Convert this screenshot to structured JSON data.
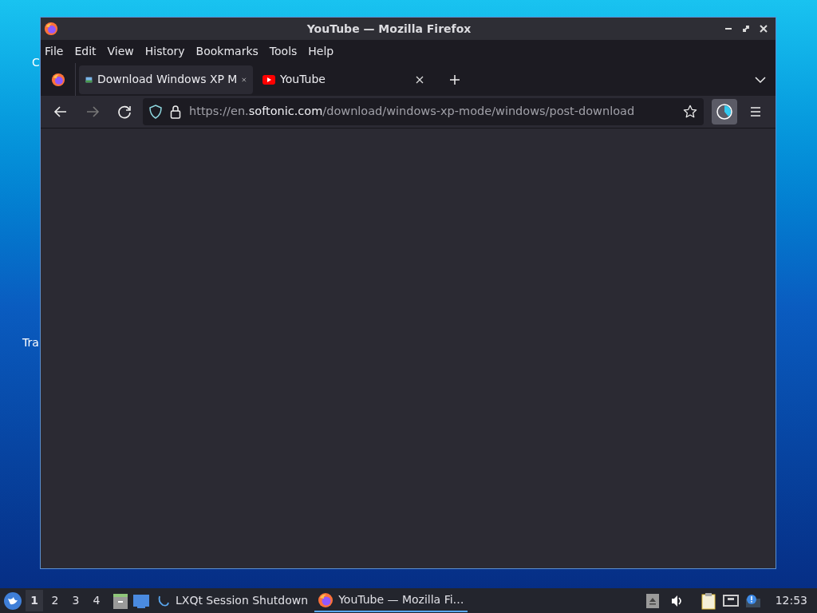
{
  "desktop_icons": [
    {
      "label": "C"
    },
    {
      "label": "Tra"
    }
  ],
  "window": {
    "title": "YouTube — Mozilla Firefox"
  },
  "menu": [
    "File",
    "Edit",
    "View",
    "History",
    "Bookmarks",
    "Tools",
    "Help"
  ],
  "tabs": [
    {
      "label": "Download Windows XP M",
      "selected": true,
      "kind": "page"
    },
    {
      "label": "YouTube",
      "selected": false,
      "kind": "video"
    }
  ],
  "url": {
    "prefix": "https://en.",
    "domain": "softonic.com",
    "path": "/download/windows-xp-mode/windows/post-download"
  },
  "taskbar": {
    "desktops": [
      {
        "label": "1",
        "selected": true
      },
      {
        "label": "2",
        "selected": false
      },
      {
        "label": "3",
        "selected": false
      },
      {
        "label": "4",
        "selected": false
      }
    ],
    "tasks": [
      {
        "label": "LXQt Session Shutdown",
        "selected": false,
        "kind": "session"
      },
      {
        "label": "YouTube — Mozilla Fi…",
        "selected": true,
        "kind": "firefox"
      }
    ],
    "clock": "12:53"
  }
}
